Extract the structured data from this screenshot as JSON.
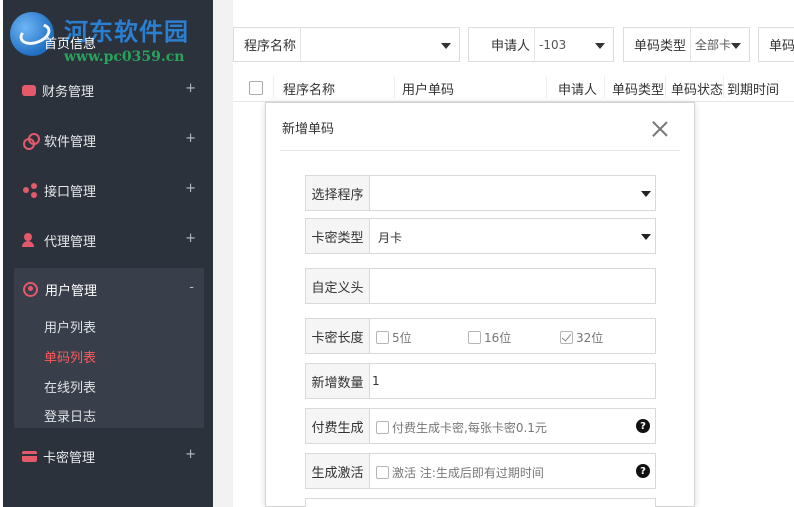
{
  "watermark": {
    "brand": "河东软件园",
    "url": "www.pc0359.cn"
  },
  "sidebar": {
    "home": "首页信息",
    "items": [
      {
        "label": "财务管理",
        "icon": "wallet-icon",
        "expand": "+"
      },
      {
        "label": "软件管理",
        "icon": "link-icon",
        "expand": "+"
      },
      {
        "label": "接口管理",
        "icon": "share-icon",
        "expand": "+"
      },
      {
        "label": "代理管理",
        "icon": "agent-icon",
        "expand": "+"
      },
      {
        "label": "用户管理",
        "icon": "user-icon",
        "expand": "-"
      },
      {
        "label": "卡密管理",
        "icon": "card-icon",
        "expand": "+"
      }
    ],
    "sub_items": [
      "用户列表",
      "单码列表",
      "在线列表",
      "登录日志"
    ],
    "accent": "#e45a6b",
    "active_color": "#ff5a5a"
  },
  "filters": [
    {
      "label": "程序名称",
      "value": ""
    },
    {
      "label": "申请人",
      "value": "-103"
    },
    {
      "label": "单码类型",
      "value": "全部卡"
    },
    {
      "label": "单码"
    }
  ],
  "table": {
    "headers": [
      "程序名称",
      "用户单码",
      "申请人",
      "单码类型",
      "单码状态",
      "到期时间"
    ]
  },
  "modal": {
    "title": "新增单码",
    "select_program": {
      "label": "选择程序",
      "value": ""
    },
    "card_type": {
      "label": "卡密类型",
      "value": "月卡"
    },
    "custom_prefix": {
      "label": "自定义头",
      "value": ""
    },
    "card_length": {
      "label": "卡密长度",
      "options": [
        "5位",
        "16位",
        "32位"
      ],
      "checked": "32位"
    },
    "quantity": {
      "label": "新增数量",
      "value": "1"
    },
    "paid": {
      "label": "付费生成",
      "text": "付费生成卡密,每张卡密0.1元",
      "help": "?"
    },
    "activate": {
      "label": "生成激活",
      "text": "激活 注:生成后即有过期时间",
      "help": "?"
    }
  }
}
